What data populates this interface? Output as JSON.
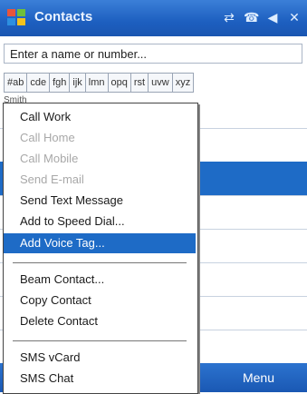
{
  "window": {
    "title": "Contacts"
  },
  "status_icons": [
    "connectivity-icon",
    "phone-icon",
    "volume-icon",
    "close-icon"
  ],
  "search": {
    "placeholder": "Enter a name or number..."
  },
  "alpha_tabs": [
    "#ab",
    "cde",
    "fgh",
    "ijk",
    "lmn",
    "opq",
    "rst",
    "uvw",
    "xyz"
  ],
  "list_header": "Smith",
  "menu": {
    "items": [
      {
        "label": "Call Work",
        "disabled": false
      },
      {
        "label": "Call Home",
        "disabled": true
      },
      {
        "label": "Call Mobile",
        "disabled": true
      },
      {
        "label": "Send E-mail",
        "disabled": true
      },
      {
        "label": "Send Text Message",
        "disabled": false
      },
      {
        "label": "Add to Speed Dial...",
        "disabled": false
      },
      {
        "label": "Add Voice Tag...",
        "disabled": false,
        "highlighted": true
      },
      {
        "label": "Beam Contact...",
        "disabled": false
      },
      {
        "label": "Copy Contact",
        "disabled": false
      },
      {
        "label": "Delete Contact",
        "disabled": false
      },
      {
        "label": "SMS vCard",
        "disabled": false
      },
      {
        "label": "SMS Chat",
        "disabled": false
      }
    ]
  },
  "softkeys": {
    "right": "Menu"
  },
  "colors": {
    "accent": "#1e6bc6",
    "titlebar": "#1d5fc0"
  }
}
